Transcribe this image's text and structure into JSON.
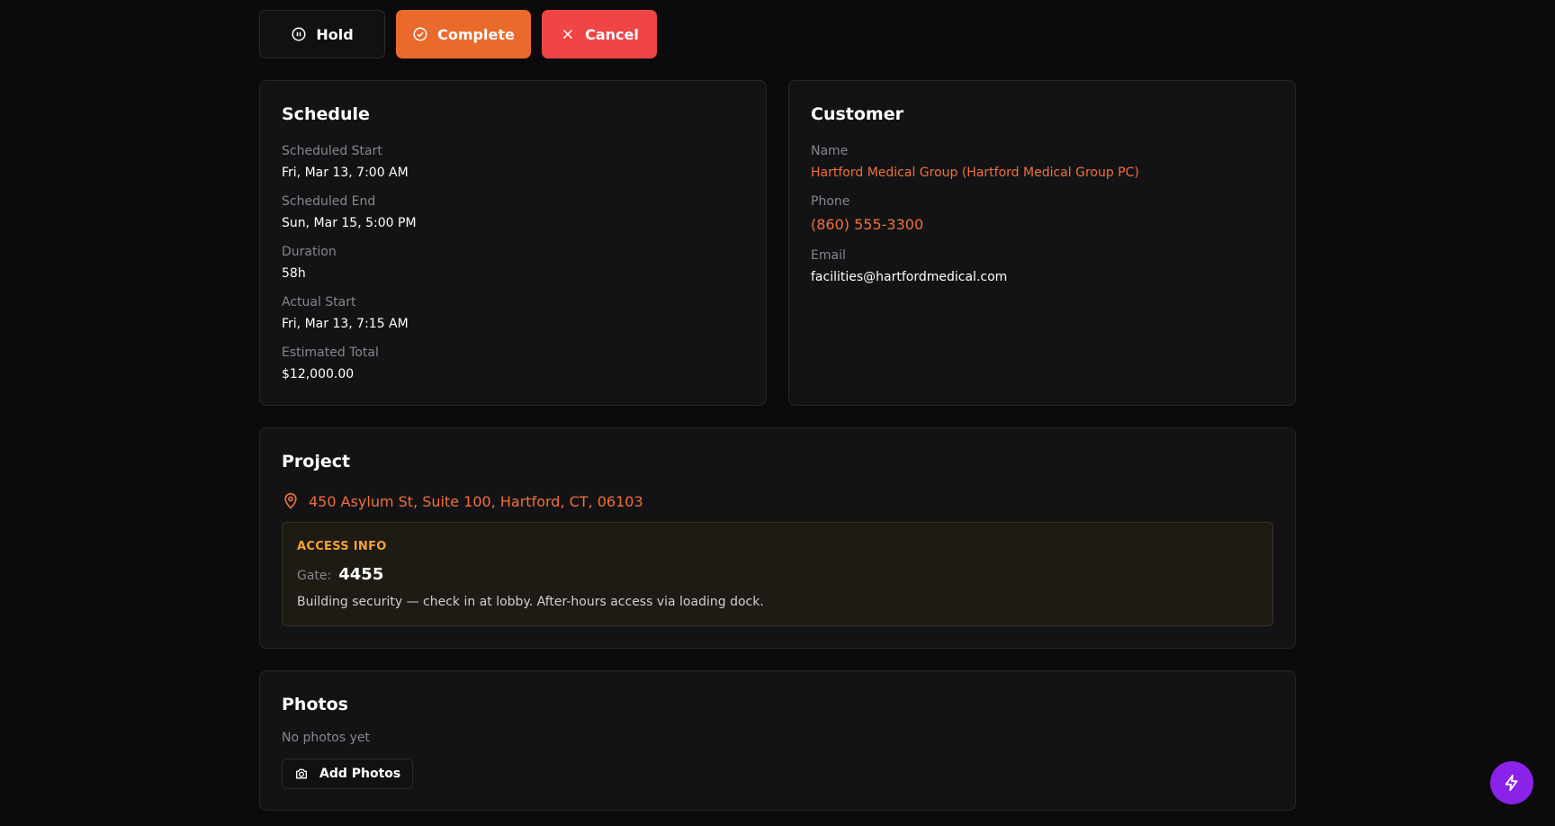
{
  "actions": {
    "hold": "Hold",
    "complete": "Complete",
    "cancel": "Cancel"
  },
  "schedule": {
    "title": "Schedule",
    "fields": [
      {
        "label": "Scheduled Start",
        "value": "Fri, Mar 13, 7:00 AM"
      },
      {
        "label": "Scheduled End",
        "value": "Sun, Mar 15, 5:00 PM"
      },
      {
        "label": "Duration",
        "value": "58h"
      },
      {
        "label": "Actual Start",
        "value": "Fri, Mar 13, 7:15 AM"
      },
      {
        "label": "Estimated Total",
        "value": "$12,000.00"
      }
    ]
  },
  "customer": {
    "title": "Customer",
    "name_label": "Name",
    "name": "Hartford Medical Group (Hartford Medical Group PC)",
    "phone_label": "Phone",
    "phone": "(860) 555-3300",
    "email_label": "Email",
    "email": "facilities@hartfordmedical.com"
  },
  "project": {
    "title": "Project",
    "address": "450 Asylum St, Suite 100, Hartford, CT, 06103",
    "access": {
      "title": "ACCESS INFO",
      "gate_label": "Gate:",
      "gate_code": "4455",
      "note": "Building security — check in at lobby. After-hours access via loading dock."
    }
  },
  "photos": {
    "title": "Photos",
    "empty": "No photos yet",
    "add_label": "Add Photos"
  },
  "colors": {
    "accent": "#ea6a2c",
    "danger": "#ef4545",
    "fab": "#8a22e8",
    "access_title": "#f5a233"
  }
}
